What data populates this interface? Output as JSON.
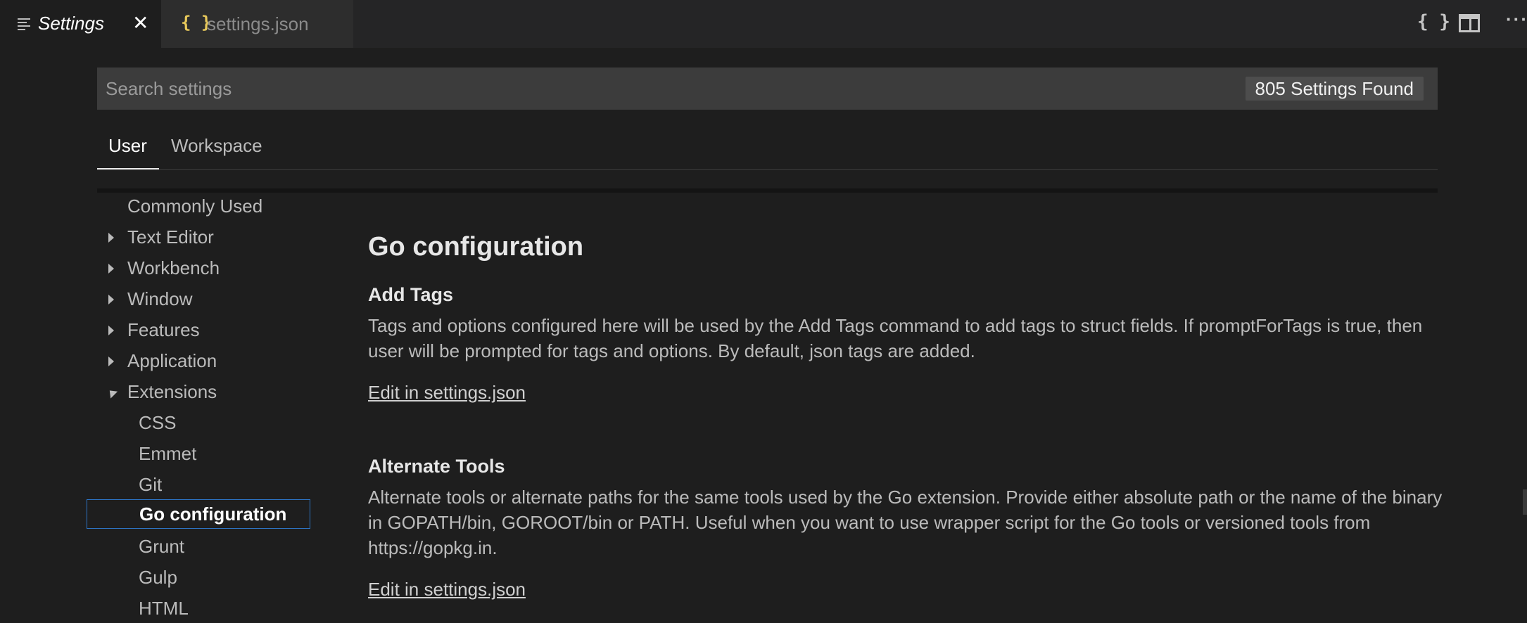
{
  "tabs": [
    {
      "label": "Settings",
      "icon": "list-lines-icon"
    },
    {
      "label": "settings.json",
      "icon": "json-braces-icon"
    }
  ],
  "tab_close": "✕",
  "actions": {
    "open_json": "{ }",
    "more": "···"
  },
  "search": {
    "placeholder": "Search settings",
    "result": "805 Settings Found"
  },
  "scopes": {
    "user": "User",
    "workspace": "Workspace"
  },
  "toc": {
    "commonly_used": "Commonly Used",
    "text_editor": "Text Editor",
    "workbench": "Workbench",
    "window": "Window",
    "features": "Features",
    "application": "Application",
    "extensions": "Extensions",
    "css": "CSS",
    "emmet": "Emmet",
    "git": "Git",
    "go_configuration": "Go configuration",
    "grunt": "Grunt",
    "gulp": "Gulp",
    "html": "HTML"
  },
  "content": {
    "section_title": "Go configuration",
    "settings": [
      {
        "title": "Add Tags",
        "description": "Tags and options configured here will be used by the Add Tags command to add tags to struct fields. If promptForTags is true, then user will be prompted for tags and options. By default, json tags are added.",
        "link": "Edit in settings.json"
      },
      {
        "title": "Alternate Tools",
        "description": "Alternate tools or alternate paths for the same tools used by the Go extension. Provide either absolute path or the name of the binary in GOPATH/bin, GOROOT/bin or PATH. Useful when you want to use wrapper script for the Go tools or versioned tools from https://gopkg.in.",
        "link": "Edit in settings.json"
      }
    ]
  },
  "colors": {
    "accent_focus": "#2d74c4",
    "json_icon": "#e8c95b",
    "background": "#1e1e1e"
  }
}
